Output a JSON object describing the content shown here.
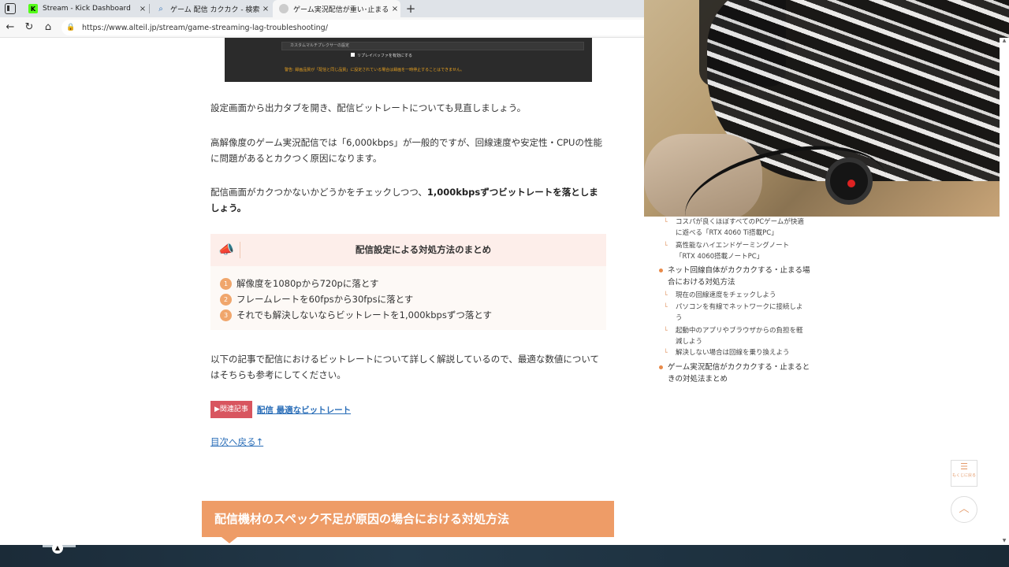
{
  "browser": {
    "tabs": [
      {
        "label": "Stream - Kick Dashboard",
        "favicon": "kick-icon",
        "active": false
      },
      {
        "label": "ゲーム 配信 カクカク - 検索",
        "favicon": "search-icon",
        "active": false
      },
      {
        "label": "ゲーム実況配信が重い･止まる･カクカ",
        "favicon": "site-icon",
        "active": true
      }
    ],
    "new_tab_label": "+",
    "close_glyph": "×",
    "url": "https://www.alteil.jp/stream/game-streaming-lag-troubleshooting/"
  },
  "figure": {
    "panel_label": "カスタムマルチプレクサーの設定",
    "checkbox_label": "リプレイバッファを有効にする",
    "warning": "警告: 録画品質が「配信と同じ品質」に設定されている場合は録画を一時停止することはできません。"
  },
  "article": {
    "p1": "設定画面から出力タブを開き、配信ビットレートについても見直しましょう。",
    "p2": "高解像度のゲーム実況配信では「6,000kbps」が一般的ですが、回線速度や安定性・CPUの性能に問題があるとカクつく原因になります。",
    "p3_plain": "配信画面がカクつかないかどうかをチェックしつつ、",
    "p3_bold": "1,000kbpsずつビットレートを落としましょう。",
    "summary": {
      "title": "配信設定による対処方法のまとめ",
      "items": [
        {
          "num": "1",
          "text": "解像度を1080pから720pに落とす"
        },
        {
          "num": "2",
          "text": "フレームレートを60fpsから30fpsに落とす"
        },
        {
          "num": "3",
          "text": "それでも解決しないならビットレートを1,000kbpsずつ落とす"
        }
      ]
    },
    "p4": "以下の記事で配信におけるビットレートについて詳しく解説しているので、最適な数値についてはそちらも参考にしてください。",
    "related_badge": "▶関連記事",
    "related_link": "配信 最適なビットレート",
    "toc_back": "目次へ戻る↑",
    "section_heading": "配信機材のスペック不足が原因の場合における対処方法"
  },
  "sidebar": {
    "items": [
      {
        "kind": "sub",
        "text": "コスパが良くほぼすべてのPCゲームが快適に遊べる「RTX 4060 Ti搭載PC」"
      },
      {
        "kind": "sub",
        "text": "高性能なハイエンドゲーミングノート「RTX 4060搭載ノートPC」"
      },
      {
        "kind": "main",
        "text": "ネット回線自体がカクカクする・止まる場合における対処方法"
      },
      {
        "kind": "sub",
        "text": "現在の回線速度をチェックしよう"
      },
      {
        "kind": "sub",
        "text": "パソコンを有線でネットワークに接続しよう"
      },
      {
        "kind": "sub",
        "text": "起動中のアプリやブラウザからの負担を軽減しよう"
      },
      {
        "kind": "sub",
        "text": "解決しない場合は回線を乗り換えよう"
      },
      {
        "kind": "main",
        "text": "ゲーム実況配信がカクカクする・止まるときの対処法まとめ"
      }
    ]
  },
  "floating": {
    "toc_label": "もくじに戻る",
    "toc_icon": "list-icon",
    "top_icon": "chevron-up-icon"
  },
  "colors": {
    "accent": "#ee9c67",
    "link": "#2a6eb8",
    "badge": "#d8555f"
  }
}
